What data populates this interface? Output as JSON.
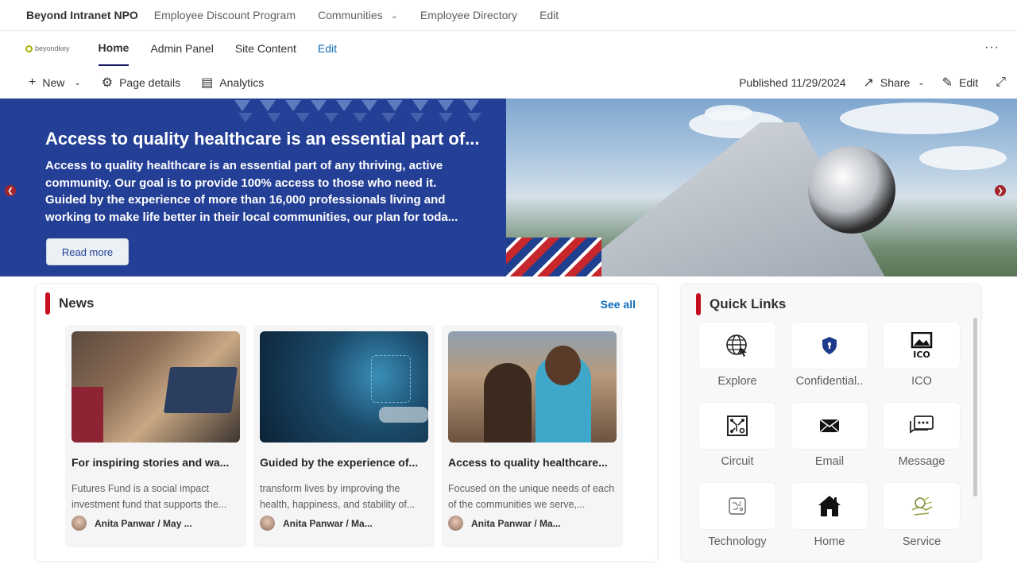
{
  "topnav": {
    "site_name": "Beyond Intranet NPO",
    "links": [
      "Employee Discount Program",
      "Communities",
      "Employee Directory",
      "Edit"
    ]
  },
  "sitenav": {
    "logo_text": "beyondkey",
    "links": [
      "Home",
      "Admin Panel",
      "Site Content",
      "Edit"
    ],
    "active": "Home"
  },
  "commandbar": {
    "new_label": "New",
    "page_details_label": "Page details",
    "analytics_label": "Analytics",
    "published": "Published 11/29/2024",
    "share_label": "Share",
    "edit_label": "Edit"
  },
  "hero": {
    "title": "Access to quality healthcare is an essential part of...",
    "description": "Access to quality healthcare is an essential part of any thriving, active community. Our goal is to provide 100% access to those who need it. Guided by the experience of more than 16,000 professionals living and working to make life better in their local communities, our plan for toda...",
    "button_label": "Read more"
  },
  "news": {
    "heading": "News",
    "see_all": "See all",
    "items": [
      {
        "title": "For inspiring stories and wa...",
        "description": "Futures Fund is a social impact investment fund that supports the...",
        "author": "Anita Panwar / May ..."
      },
      {
        "title": "Guided by the experience of...",
        "description": "transform lives by improving the health, happiness, and stability of...",
        "author": "Anita Panwar / Ma..."
      },
      {
        "title": "Access to quality healthcare...",
        "description": "Focused on the unique needs of each of the communities we serve,...",
        "author": "Anita Panwar / Ma..."
      }
    ]
  },
  "quicklinks": {
    "heading": "Quick Links",
    "items": [
      {
        "label": "Explore",
        "icon": "globe-icon"
      },
      {
        "label": "Confidential..",
        "icon": "shield-icon"
      },
      {
        "label": "ICO",
        "icon": "ico-icon"
      },
      {
        "label": "Circuit",
        "icon": "circuit-icon"
      },
      {
        "label": "Email",
        "icon": "envelope-icon"
      },
      {
        "label": "Message",
        "icon": "message-icon"
      },
      {
        "label": "Technology",
        "icon": "chip-icon"
      },
      {
        "label": "Home",
        "icon": "home-icon"
      },
      {
        "label": "Service",
        "icon": "service-icon"
      }
    ]
  },
  "colors": {
    "hero_bg": "#243f96",
    "accent_red": "#c50f1f",
    "link_blue": "#0f6cbd"
  }
}
